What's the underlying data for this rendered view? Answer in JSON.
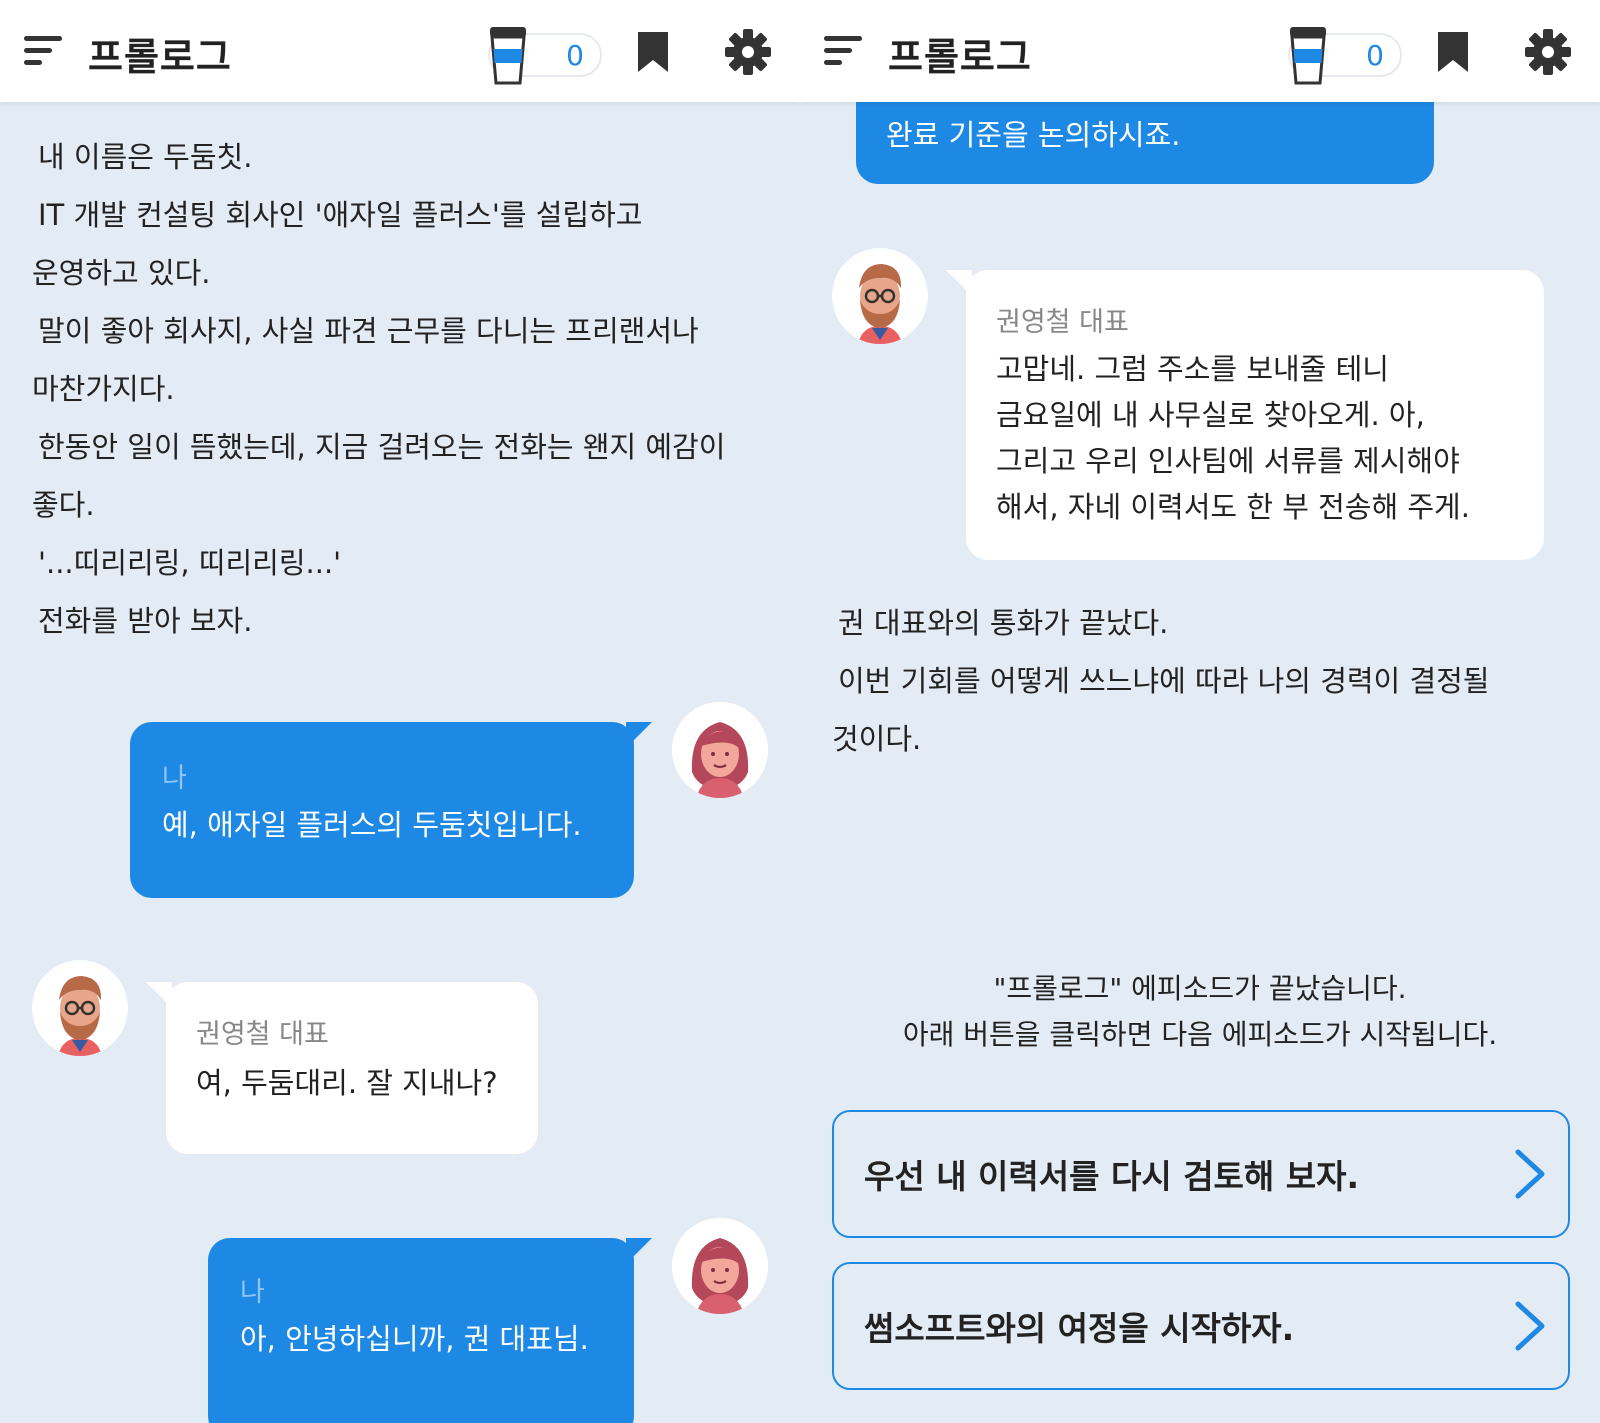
{
  "header": {
    "title": "프롤로그",
    "coffee_count": "0"
  },
  "left": {
    "narration": [
      "내 이름은 두둠칫.",
      "IT 개발 컨설팅 회사인 '애자일 플러스'를 설립하고",
      "운영하고 있다.",
      "말이 좋아 회사지, 사실 파견 근무를 다니는 프리랜서나",
      "마찬가지다.",
      "한동안 일이 뜸했는데, 지금 걸려오는 전화는 왠지 예감이",
      "좋다.",
      "'...띠리리링, 띠리리링...'",
      "전화를 받아 보자."
    ],
    "msg1": {
      "speaker": "나",
      "text": "예, 애자일 플러스의 두둠칫입니다."
    },
    "msg2": {
      "speaker": "권영철 대표",
      "text": "여, 두둠대리. 잘 지내나?"
    },
    "msg3": {
      "speaker": "나",
      "text": "아, 안녕하십니까, 권 대표님."
    }
  },
  "right": {
    "partial_msg": "완료 기준을 논의하시죠.",
    "msg4": {
      "speaker": "권영철 대표",
      "lines": [
        "고맙네. 그럼 주소를 보내줄 테니",
        "금요일에 내 사무실로 찾아오게. 아,",
        "그리고 우리 인사팀에 서류를 제시해야",
        "해서, 자네 이력서도 한 부 전송해 주게."
      ]
    },
    "narration": [
      "권 대표와의 통화가 끝났다.",
      "이번 기회를 어떻게 쓰느냐에 따라 나의 경력이 결정될",
      "것이다."
    ],
    "episode_end": [
      "\"프롤로그\" 에피소드가 끝났습니다.",
      "아래 버튼을 클릭하면 다음 에피소드가 시작됩니다."
    ],
    "choices": [
      "우선 내 이력서를 다시 검토해 보자.",
      "썸소프트와의 여정을 시작하자."
    ]
  },
  "colors": {
    "accent": "#1e88e5",
    "background": "#e3ebf5",
    "header": "#ffffff"
  }
}
